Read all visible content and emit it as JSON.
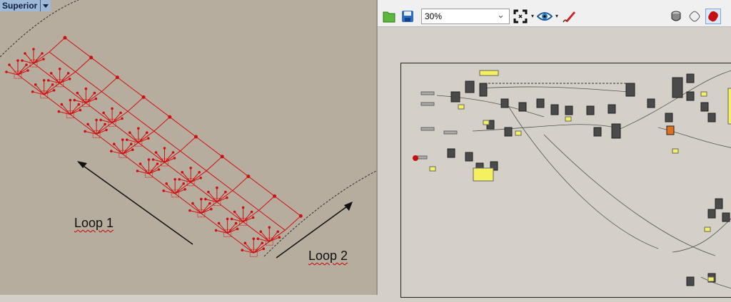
{
  "viewport": {
    "title": "Superior",
    "annotations": [
      {
        "label": "Loop 1"
      },
      {
        "label": "Loop 2"
      }
    ],
    "colors": {
      "geometry": "#d01010",
      "background": "#b6ad9e"
    }
  },
  "grasshopper": {
    "toolbar": {
      "zoom_value": "30%",
      "icons": [
        "open-file-icon",
        "save-file-icon",
        "zoom-extents-icon",
        "preview-eye-icon",
        "sketch-pen-icon",
        "preview-wireframe-icon",
        "preview-shaded-icon",
        "preview-selected-icon"
      ]
    },
    "colors": {
      "panel": "#f5f060",
      "component": "#505050",
      "canvas": "#d4d0c8"
    }
  }
}
